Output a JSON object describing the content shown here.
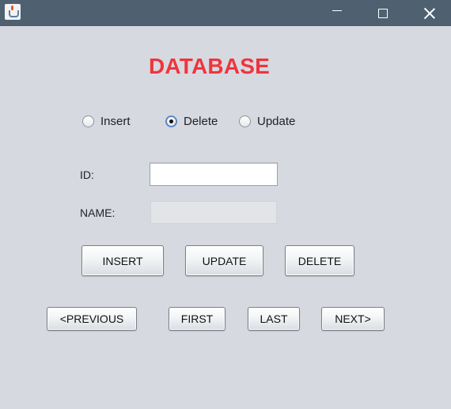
{
  "window": {
    "title": "",
    "icon": "java-cup-icon",
    "controls": [
      "minimize-icon",
      "maximize-icon",
      "close-icon"
    ]
  },
  "heading": "DATABASE",
  "colors": {
    "heading": "#f0343c",
    "titlebar": "#4f6170",
    "background": "#d6d9df"
  },
  "mode_options": [
    {
      "label": "Insert",
      "checked": false
    },
    {
      "label": "Delete",
      "checked": true
    },
    {
      "label": "Update",
      "checked": false
    }
  ],
  "form": {
    "id_label": "ID:",
    "id_value": "",
    "name_label": "NAME:",
    "name_value": "",
    "name_enabled": false
  },
  "actions": {
    "insert": "INSERT",
    "update": "UPDATE",
    "delete": "DELETE"
  },
  "navigation": {
    "previous": "<PREVIOUS",
    "first": "FIRST",
    "last": "LAST",
    "next": "NEXT>"
  }
}
